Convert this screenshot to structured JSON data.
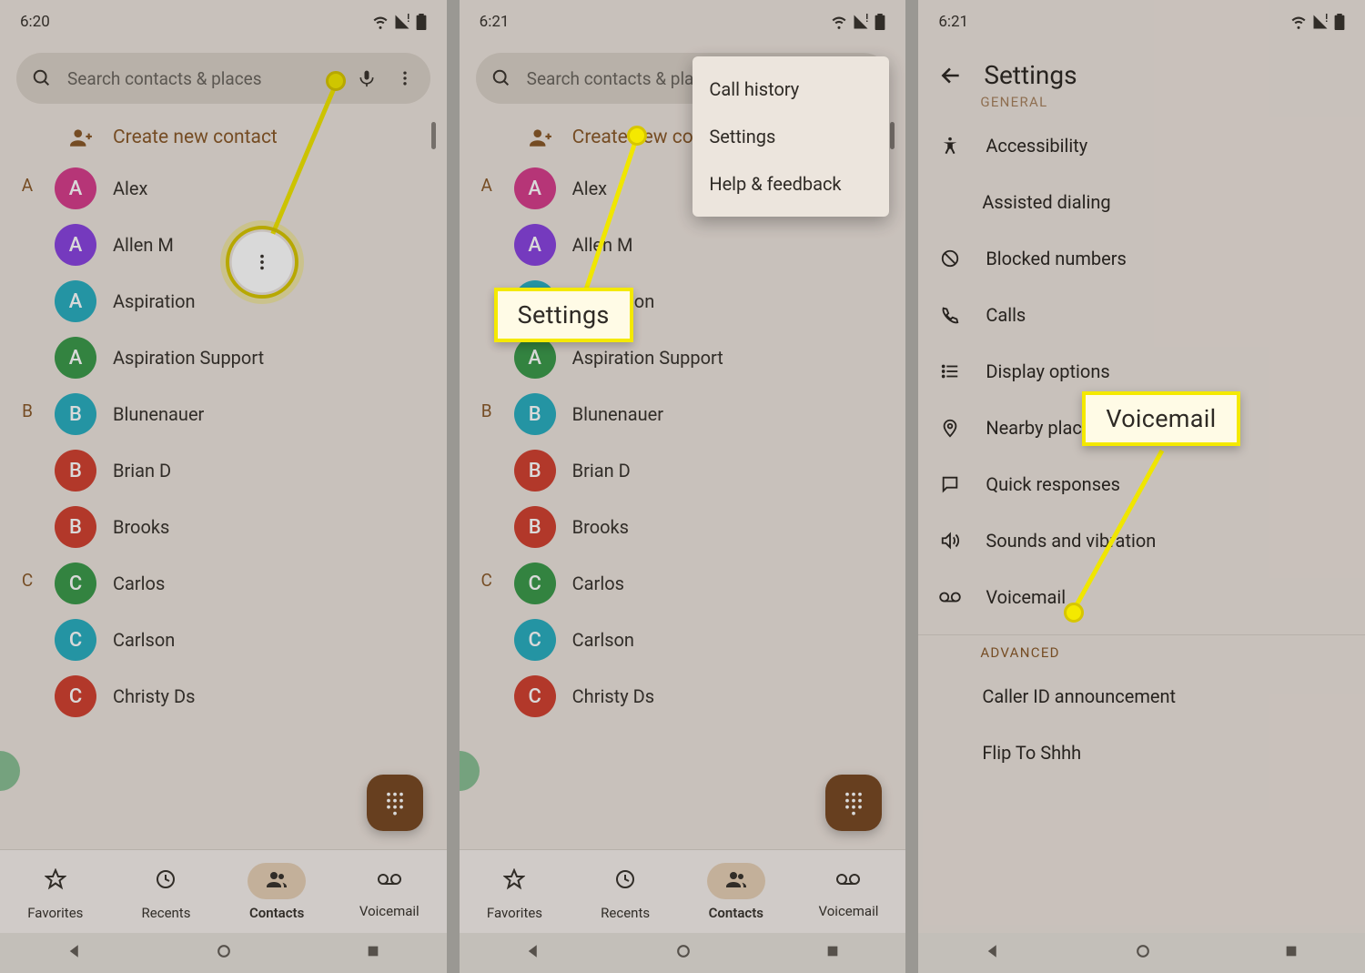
{
  "statusIcons": [
    "wifi",
    "signal-alert",
    "battery"
  ],
  "screens": {
    "s1": {
      "time": "6:20"
    },
    "s2": {
      "time": "6:21"
    },
    "s3": {
      "time": "6:21"
    }
  },
  "search": {
    "placeholder": "Search contacts & places"
  },
  "createContact": "Create new contact",
  "contacts": [
    {
      "letter": "A",
      "items": [
        {
          "name": "Alex",
          "initial": "A",
          "color": "#d63f8c"
        },
        {
          "name": "Allen M",
          "initial": "A",
          "color": "#8a45e0"
        },
        {
          "name": "Aspiration",
          "initial": "A",
          "color": "#2baec0"
        },
        {
          "name": "Aspiration Support",
          "initial": "A",
          "color": "#3c9a4c"
        }
      ]
    },
    {
      "letter": "B",
      "items": [
        {
          "name": "Blunenauer",
          "initial": "B",
          "color": "#2baec0"
        },
        {
          "name": "Brian D",
          "initial": "B",
          "color": "#d24232"
        },
        {
          "name": "Brooks",
          "initial": "B",
          "color": "#d24232"
        }
      ]
    },
    {
      "letter": "C",
      "items": [
        {
          "name": "Carlos",
          "initial": "C",
          "color": "#3c9a4c"
        },
        {
          "name": "Carlson",
          "initial": "C",
          "color": "#2baec0"
        },
        {
          "name": "Christy Ds",
          "initial": "C",
          "color": "#d24232"
        }
      ]
    }
  ],
  "nav": {
    "favorites": "Favorites",
    "recents": "Recents",
    "contacts": "Contacts",
    "voicemail": "Voicemail"
  },
  "menu": {
    "callHistory": "Call history",
    "settings": "Settings",
    "helpFeedback": "Help & feedback"
  },
  "settingsPage": {
    "title": "Settings",
    "general": "GENERAL",
    "advanced": "ADVANCED",
    "items": {
      "accessibility": "Accessibility",
      "assisted": "Assisted dialing",
      "blocked": "Blocked numbers",
      "calls": "Calls",
      "display": "Display options",
      "nearby": "Nearby places",
      "quick": "Quick responses",
      "sounds": "Sounds and vibration",
      "voicemail": "Voicemail",
      "callerId": "Caller ID announcement",
      "flip": "Flip To Shhh"
    }
  },
  "callouts": {
    "settings": "Settings",
    "voicemail": "Voicemail"
  }
}
